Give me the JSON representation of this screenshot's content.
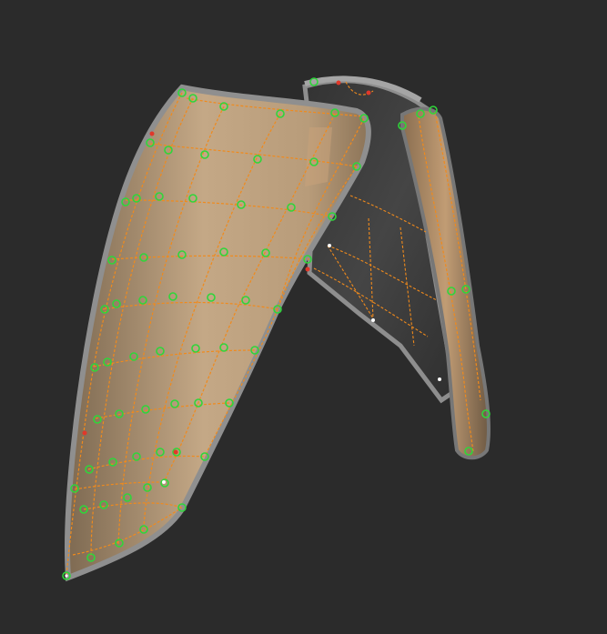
{
  "viewport": {
    "background": "#2b2b2b"
  },
  "model": {
    "object": "retopology-mesh-over-armor-shell",
    "front_shell_color": "#b59a79",
    "inner_shell_color": "#3e3e3e",
    "rim_color": "#9a9a9a",
    "edge_color": "#f08a1c",
    "vertex_marker_color": "#2fd63a",
    "pinned_marker_color": "#e0382a"
  }
}
